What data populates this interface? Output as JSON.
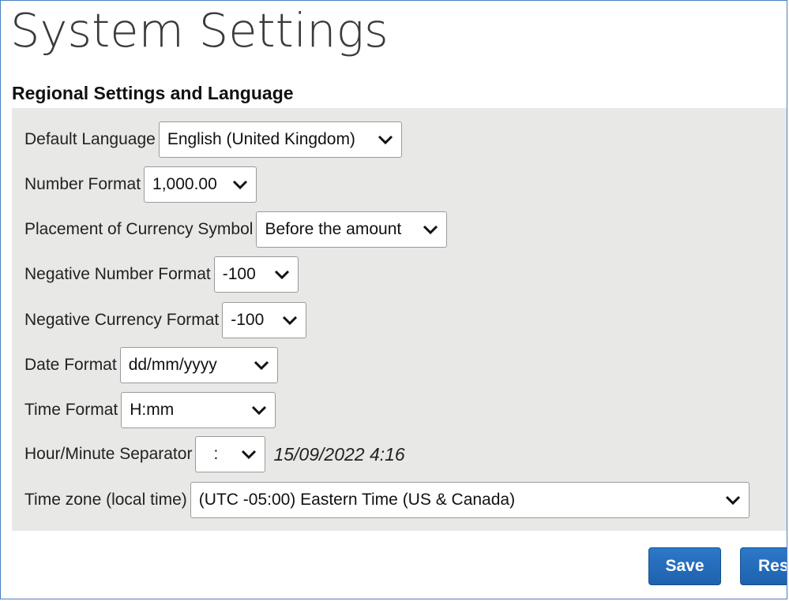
{
  "page": {
    "title": "System Settings"
  },
  "section": {
    "title": "Regional Settings and Language"
  },
  "fields": {
    "default_language": {
      "label": "Default Language",
      "value": "English (United Kingdom)"
    },
    "number_format": {
      "label": "Number Format",
      "value": "1,000.00"
    },
    "currency_placement": {
      "label": "Placement of Currency Symbol",
      "value": "Before the amount"
    },
    "negative_number_format": {
      "label": "Negative Number Format",
      "value": "-100"
    },
    "negative_currency_format": {
      "label": "Negative Currency Format",
      "value": "-100"
    },
    "date_format": {
      "label": "Date Format",
      "value": "dd/mm/yyyy"
    },
    "time_format": {
      "label": "Time Format",
      "value": "H:mm"
    },
    "hour_minute_separator": {
      "label": "Hour/Minute Separator",
      "value": ":",
      "preview": "15/09/2022 4:16"
    },
    "time_zone": {
      "label": "Time zone (local time)",
      "value": "(UTC -05:00) Eastern Time (US & Canada)"
    }
  },
  "actions": {
    "save_label": "Save",
    "reset_label": "Res"
  },
  "icons": {
    "dropdown": "chevron-down-icon"
  },
  "colors": {
    "accent": "#1e62ad",
    "panel": "#e8e8e6",
    "frame_border": "#4a7fc0"
  }
}
